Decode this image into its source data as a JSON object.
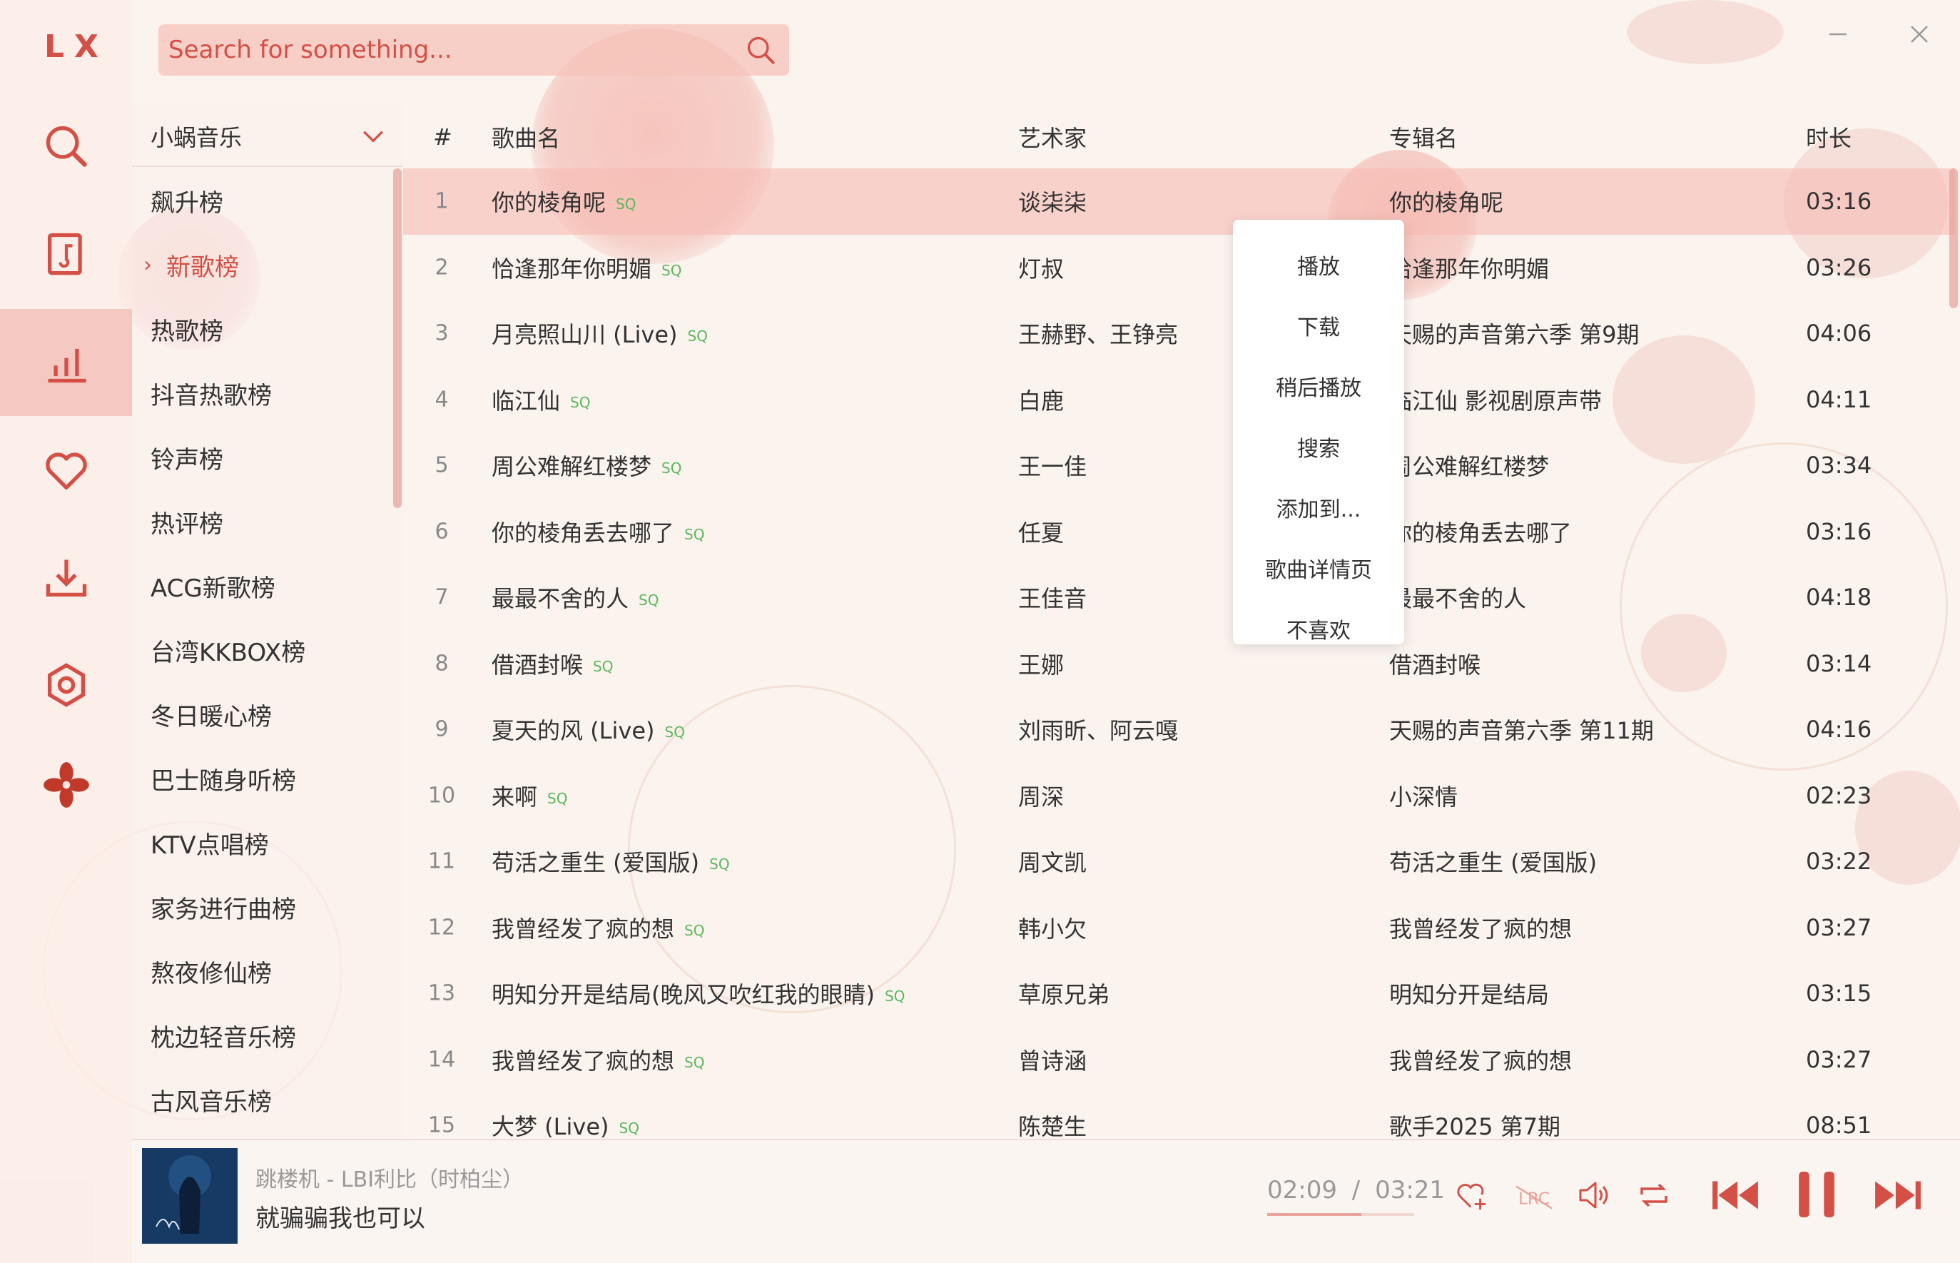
{
  "app": {
    "logo": "LX"
  },
  "nav": {
    "items": [
      {
        "name": "search",
        "icon": "search-icon"
      },
      {
        "name": "song-list",
        "icon": "music-file-icon"
      },
      {
        "name": "leaderboard",
        "icon": "chart-bars-icon",
        "active": true
      },
      {
        "name": "favorites",
        "icon": "heart-icon"
      },
      {
        "name": "download",
        "icon": "download-icon"
      },
      {
        "name": "settings",
        "icon": "gear-icon"
      }
    ]
  },
  "search": {
    "placeholder": "Search for something..."
  },
  "source": {
    "selected": "小蜗音乐"
  },
  "boards": [
    "飙升榜",
    "新歌榜",
    "热歌榜",
    "抖音热歌榜",
    "铃声榜",
    "热评榜",
    "ACG新歌榜",
    "台湾KKBOX榜",
    "冬日暖心榜",
    "巴士随身听榜",
    "KTV点唱榜",
    "家务进行曲榜",
    "熬夜修仙榜",
    "枕边轻音乐榜",
    "古风音乐榜"
  ],
  "active_board_index": 1,
  "table": {
    "headers": {
      "num": "#",
      "name": "歌曲名",
      "artist": "艺术家",
      "album": "专辑名",
      "time": "时长"
    },
    "quality_badge": "SQ",
    "rows": [
      {
        "num": "1",
        "name": "你的棱角呢",
        "artist": "谈柒柒",
        "album": "你的棱角呢",
        "time": "03:16"
      },
      {
        "num": "2",
        "name": "恰逢那年你明媚",
        "artist": "灯叔",
        "album": "恰逢那年你明媚",
        "time": "03:26"
      },
      {
        "num": "3",
        "name": "月亮照山川 (Live)",
        "artist": "王赫野、王铮亮",
        "album": "天赐的声音第六季 第9期",
        "time": "04:06"
      },
      {
        "num": "4",
        "name": "临江仙",
        "artist": "白鹿",
        "album": "临江仙 影视剧原声带",
        "time": "04:11"
      },
      {
        "num": "5",
        "name": "周公难解红楼梦",
        "artist": "王一佳",
        "album": "周公难解红楼梦",
        "time": "03:34"
      },
      {
        "num": "6",
        "name": "你的棱角丢去哪了",
        "artist": "任夏",
        "album": "你的棱角丢去哪了",
        "time": "03:16"
      },
      {
        "num": "7",
        "name": "最最不舍的人",
        "artist": "王佳音",
        "album": "最最不舍的人",
        "time": "04:18"
      },
      {
        "num": "8",
        "name": "借酒封喉",
        "artist": "王娜",
        "album": "借酒封喉",
        "time": "03:14"
      },
      {
        "num": "9",
        "name": "夏天的风 (Live)",
        "artist": "刘雨昕、阿云嘎",
        "album": "天赐的声音第六季 第11期",
        "time": "04:16"
      },
      {
        "num": "10",
        "name": "来啊",
        "artist": "周深",
        "album": "小深情",
        "time": "02:23"
      },
      {
        "num": "11",
        "name": "苟活之重生 (爱国版)",
        "artist": "周文凯",
        "album": "苟活之重生 (爱国版)",
        "time": "03:22"
      },
      {
        "num": "12",
        "name": "我曾经发了疯的想",
        "artist": "韩小欠",
        "album": "我曾经发了疯的想",
        "time": "03:27"
      },
      {
        "num": "13",
        "name": "明知分开是结局(晚风又吹红我的眼睛)",
        "artist": "草原兄弟",
        "album": "明知分开是结局",
        "time": "03:15"
      },
      {
        "num": "14",
        "name": "我曾经发了疯的想",
        "artist": "曾诗涵",
        "album": "我曾经发了疯的想",
        "time": "03:27"
      },
      {
        "num": "15",
        "name": "大梦 (Live)",
        "artist": "陈楚生",
        "album": "歌手2025 第7期",
        "time": "08:51"
      }
    ],
    "selected_row_index": 0
  },
  "context_menu": {
    "items": [
      "播放",
      "下载",
      "稍后播放",
      "搜索",
      "添加到...",
      "歌曲详情页",
      "不喜欢"
    ]
  },
  "player": {
    "track_title": "跳楼机 - LBI利比（时柏尘）",
    "lyric": "就骗骗我也可以",
    "current_time": "02:09",
    "separator": "/",
    "total_time": "03:21",
    "progress": 0.64,
    "lrc_label": "LRC"
  },
  "colors": {
    "accent": "#d44f45",
    "selected_row": "#f6bab2",
    "sq_badge": "#5cb85c"
  }
}
